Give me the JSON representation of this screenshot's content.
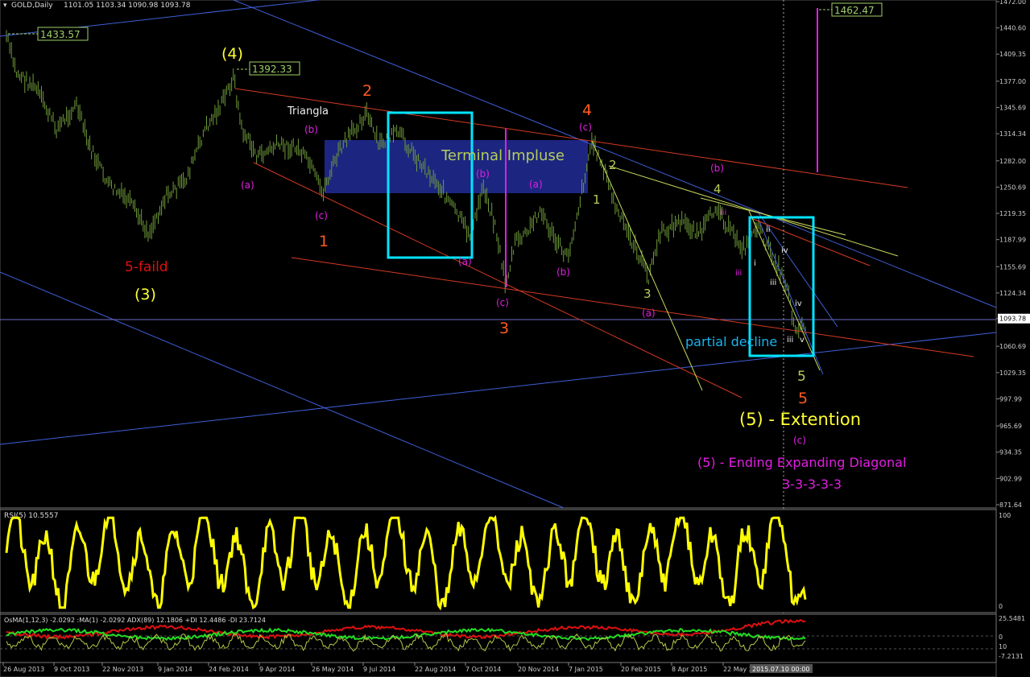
{
  "main_header": {
    "symbol_label": "GOLD,Daily",
    "ohlc": "1101.05 1103.34 1090.98 1093.78"
  },
  "rsi_header": {
    "label": "RSI(5) 10.5557"
  },
  "osc_header": {
    "label": "OsMA(1,12,3) -2.0292  :MA(1) -2.0292  ADX(89) 12.1806  +DI 12.4486  -DI 23.7124"
  },
  "price_axis": {
    "ticks": [
      "1472.00",
      "1440.60",
      "1409.35",
      "1377.00",
      "1345.69",
      "1314.34",
      "1282.00",
      "1250.69",
      "1219.35",
      "1187.99",
      "1155.69",
      "1124.34",
      "1093.78",
      "1060.69",
      "1029.35",
      "997.99",
      "965.69",
      "934.35",
      "902.99",
      "871.64"
    ],
    "current": "1093.78"
  },
  "rsi_axis": {
    "ticks": [
      "100",
      "0"
    ]
  },
  "osc_axis": {
    "ticks": [
      "25.5481",
      "0",
      "10",
      "-7.2131"
    ]
  },
  "time_axis": {
    "labels": [
      "26 Aug 2013",
      "9 Oct 2013",
      "22 Nov 2013",
      "9 Jan 2014",
      "24 Feb 2014",
      "9 Apr 2014",
      "26 May 2014",
      "9 Jul 2014",
      "22 Aug 2014",
      "7 Oct 2014",
      "20 Nov 2014",
      "7 Jan 2015",
      "20 Feb 2015",
      "8 Apr 2015",
      "22 May 2015"
    ],
    "cursor_label": "2015.07.10 00:00"
  },
  "price_tags": {
    "p1433": "1433.57",
    "p1392": "1392.33",
    "p1462": "1462.47"
  },
  "annotations": {
    "wave4_big": "(4)",
    "wave3_big": "(3)",
    "fail5": "5-faild",
    "triangle": "Triangla",
    "terminal": "Terminal Impluse",
    "partial": "partial decline",
    "extension": "(5) -   Extention",
    "ending_diag": "(5) - Ending Expanding Diagonal",
    "three_count": "3-3-3-3-3",
    "n1": "1",
    "n2": "2",
    "n3": "3",
    "n4": "4",
    "n5": "5",
    "g1": "1",
    "g2": "2",
    "g3": "3",
    "g4": "4",
    "g5": "5",
    "pa": "(a)",
    "pb": "(b)",
    "pc": "(c)",
    "r_i": "i",
    "r_ii": "ii",
    "r_iii": "iii",
    "r_iv": "iv",
    "r_v": "v"
  },
  "colors": {
    "background": "#000000",
    "candles": "#6f9a3a",
    "rsi_line": "#ffff00",
    "trendline_blue": "#3f5fd8",
    "trendline_red": "#d43a22",
    "highlight_box": "#00e5ff",
    "terminal_zone": "#1f2a8f",
    "magenta": "#e21ee2",
    "orange": "#ff5a1e",
    "yellow": "#ffff33",
    "greenish": "#b7cc5a",
    "osc_red": "#e01010",
    "osc_green": "#22dd22",
    "osc_olive": "#b5c848"
  },
  "chart_data": [
    {
      "type": "candlestick",
      "title": "GOLD,Daily",
      "ylim": [
        871.64,
        1472.0
      ],
      "x_range": [
        "26 Aug 2013",
        "2015.07.10"
      ],
      "x": [
        "26 Aug 2013",
        "9 Oct 2013",
        "22 Nov 2013",
        "9 Jan 2014",
        "24 Feb 2014",
        "9 Apr 2014",
        "26 May 2014",
        "9 Jul 2014",
        "22 Aug 2014",
        "7 Oct 2014",
        "20 Nov 2014",
        "7 Jan 2015",
        "20 Feb 2015",
        "8 Apr 2015",
        "22 May 2015",
        "2015.07.10"
      ],
      "series": [
        {
          "values": [
            1415,
            1325,
            1240,
            1245,
            1335,
            1290,
            1265,
            1320,
            1275,
            1222,
            1195,
            1208,
            1233,
            1200,
            1185,
            1094
          ]
        }
      ],
      "last": {
        "open": 1101.05,
        "high": 1103.34,
        "low": 1090.98,
        "close": 1093.78
      }
    },
    {
      "type": "line",
      "title": "RSI(5) 10.5557",
      "ylim": [
        0,
        100
      ],
      "x": [
        "26 Aug 2013",
        "9 Oct 2013",
        "22 Nov 2013",
        "9 Jan 2014",
        "24 Feb 2014",
        "9 Apr 2014",
        "26 May 2014",
        "9 Jul 2014",
        "22 Aug 2014",
        "7 Oct 2014",
        "20 Nov 2014",
        "7 Jan 2015",
        "20 Feb 2015",
        "8 Apr 2015",
        "22 May 2015",
        "2015.07.10"
      ],
      "series": [
        {
          "values": [
            80,
            30,
            70,
            20,
            85,
            55,
            25,
            80,
            45,
            15,
            70,
            80,
            30,
            75,
            60,
            10.5557
          ]
        }
      ]
    },
    {
      "type": "line",
      "title": "OsMA(1,12,3) -2.0292  :MA(1) -2.0292  ADX(89) 12.1806  +DI 12.4486  -DI 23.7124",
      "ylim": [
        -7.2131,
        25.5481
      ],
      "series": [
        {
          "name": "ADX(89)",
          "values": [
            10,
            11,
            12,
            13,
            13,
            12,
            12,
            13,
            13,
            12,
            12,
            13,
            12,
            12,
            12,
            12.1806
          ]
        },
        {
          "name": "+DI",
          "values": [
            15,
            14,
            13,
            14,
            16,
            15,
            14,
            16,
            15,
            14,
            15,
            16,
            15,
            14,
            13,
            12.4486
          ]
        },
        {
          "name": "-DI",
          "values": [
            14,
            15,
            16,
            15,
            13,
            14,
            16,
            14,
            16,
            18,
            17,
            16,
            17,
            18,
            20,
            23.7124
          ]
        }
      ]
    }
  ]
}
